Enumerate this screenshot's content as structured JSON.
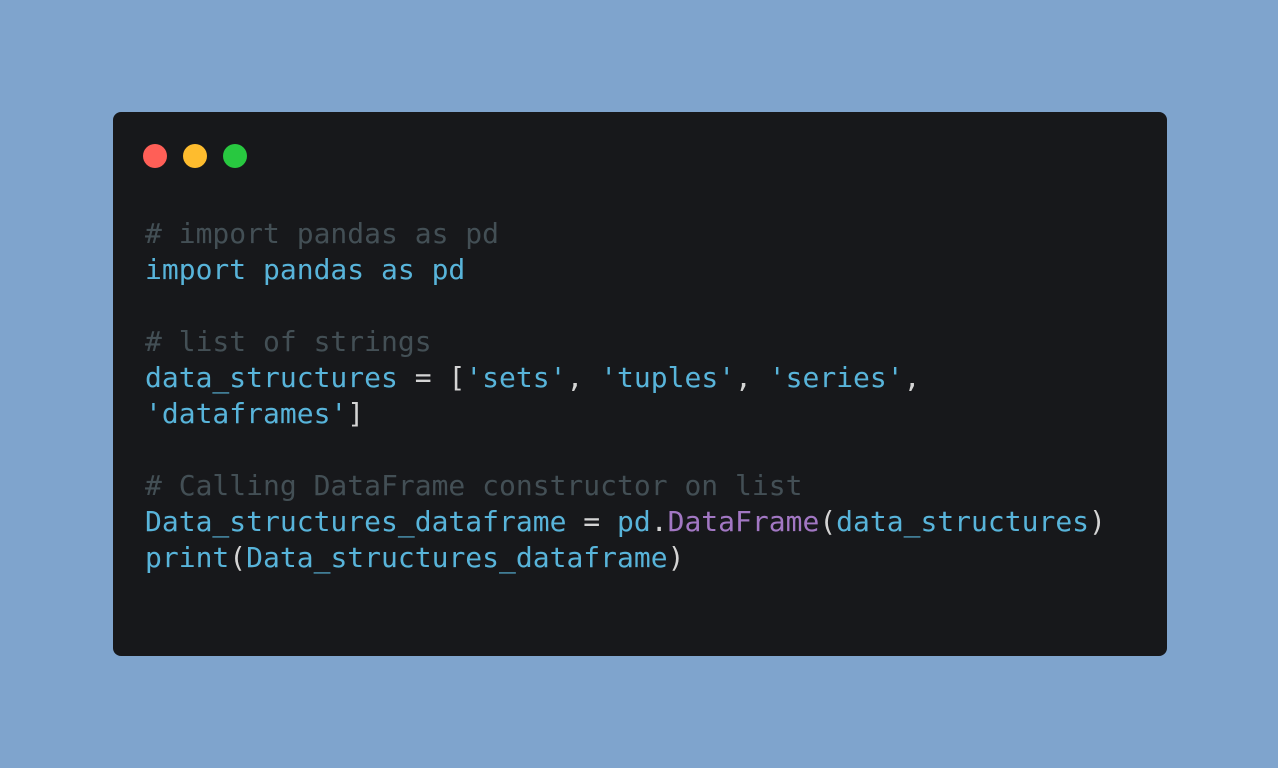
{
  "window": {
    "buttons": [
      {
        "name": "close",
        "color": "#ff5f57"
      },
      {
        "name": "minimize",
        "color": "#febc2e"
      },
      {
        "name": "maximize",
        "color": "#28c840"
      }
    ]
  },
  "colors": {
    "background": "#7fa4cd",
    "card": "#17181b",
    "comment": "#434f55",
    "identifier": "#58b4da",
    "class": "#a277c3",
    "punctuation": "#d4d4d4"
  },
  "code": {
    "lines": [
      [
        {
          "k": "comment",
          "t": "# import pandas as pd"
        }
      ],
      [
        {
          "k": "name",
          "t": "import pandas as pd"
        }
      ],
      [],
      [
        {
          "k": "comment",
          "t": "# list of strings"
        }
      ],
      [
        {
          "k": "name",
          "t": "data_structures"
        },
        {
          "k": "punct",
          "t": " = ["
        },
        {
          "k": "name",
          "t": "'sets'"
        },
        {
          "k": "punct",
          "t": ", "
        },
        {
          "k": "name",
          "t": "'tuples'"
        },
        {
          "k": "punct",
          "t": ", "
        },
        {
          "k": "name",
          "t": "'series'"
        },
        {
          "k": "punct",
          "t": ","
        }
      ],
      [
        {
          "k": "name",
          "t": "'dataframes'"
        },
        {
          "k": "punct",
          "t": "]"
        }
      ],
      [],
      [
        {
          "k": "comment",
          "t": "# Calling DataFrame constructor on list"
        }
      ],
      [
        {
          "k": "name",
          "t": "Data_structures_dataframe"
        },
        {
          "k": "punct",
          "t": " = "
        },
        {
          "k": "name",
          "t": "pd"
        },
        {
          "k": "punct",
          "t": "."
        },
        {
          "k": "class",
          "t": "DataFrame"
        },
        {
          "k": "punct",
          "t": "("
        },
        {
          "k": "name",
          "t": "data_structures"
        },
        {
          "k": "punct",
          "t": ")"
        }
      ],
      [
        {
          "k": "name",
          "t": "print"
        },
        {
          "k": "punct",
          "t": "("
        },
        {
          "k": "name",
          "t": "Data_structures_dataframe"
        },
        {
          "k": "punct",
          "t": ")"
        }
      ]
    ]
  }
}
